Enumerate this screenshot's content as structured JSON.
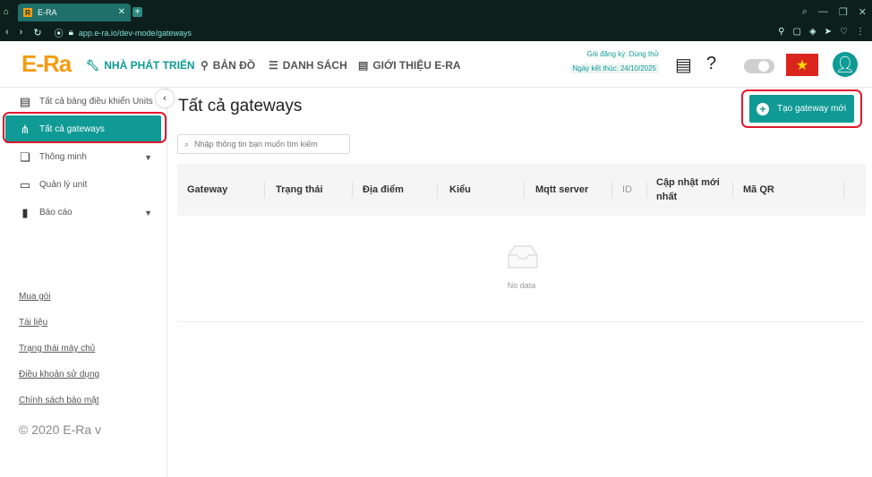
{
  "browser": {
    "tab_title": "E-RA",
    "tab_favicon": "R",
    "url": "app.e-ra.io/dev-mode/gateways",
    "window_icon": "browser-logo-icon",
    "accent_color": "#0f9a95"
  },
  "header": {
    "logo_text": "E-Ra",
    "nav": [
      {
        "label": "NHÀ PHÁT TRIỂN",
        "icon": "wrench-icon"
      },
      {
        "label": "BẢN ĐỒ",
        "icon": "map-pin-icon"
      },
      {
        "label": "DANH SÁCH",
        "icon": "list-icon"
      },
      {
        "label": "GIỚI THIỆU E-RA",
        "icon": "info-card-icon"
      }
    ],
    "plan_label": "Gói đăng ký: Dùng thử",
    "plan_end": "Ngày kết thúc: 24/10/2025"
  },
  "sidebar": {
    "items": [
      {
        "label": "Tất cả bảng điều khiển Units",
        "icon": "dashboard-icon"
      },
      {
        "label": "Tất cả gateways",
        "icon": "gateway-icon"
      },
      {
        "label": "Thông minh",
        "icon": "smart-icon"
      },
      {
        "label": "Quản lý unit",
        "icon": "unit-icon"
      },
      {
        "label": "Báo cáo",
        "icon": "chart-icon"
      }
    ],
    "links": [
      "Mua gói",
      "Tài liệu",
      "Trạng thái máy chủ",
      "Điều khoản sử dụng",
      "Chính sách bảo mật"
    ],
    "copyright": "© 2020 E-Ra v"
  },
  "main": {
    "title": "Tất cả gateways",
    "create_button": "Tạo gateway mới",
    "search_placeholder": "Nhập thông tin bạn muốn tìm kiếm",
    "columns": [
      "Gateway",
      "Trạng thái",
      "Địa điểm",
      "Kiểu",
      "Mqtt server",
      "ID",
      "Cập nhật mới nhất",
      "Mã QR"
    ],
    "empty_text": "No data"
  }
}
